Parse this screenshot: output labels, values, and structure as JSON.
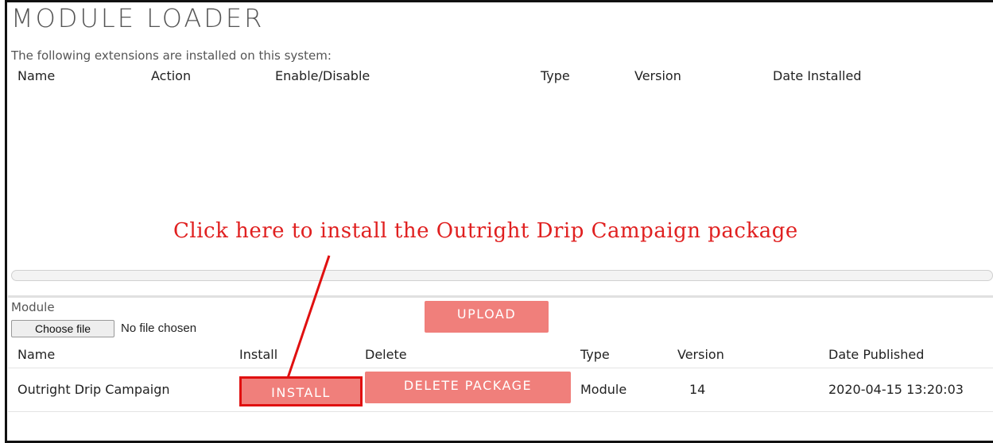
{
  "page": {
    "title": "MODULE LOADER",
    "intro": "The following extensions are installed on this system:"
  },
  "installed_table": {
    "columns": [
      "Name",
      "Action",
      "Enable/Disable",
      "Type",
      "Version",
      "Date Installed"
    ]
  },
  "annotation": {
    "text": "Click here to install the Outright Drip Campaign package",
    "color": "#e02020"
  },
  "upload": {
    "label": "Module",
    "choose_file": "Choose file",
    "file_status": "No file chosen",
    "upload_button": "UPLOAD"
  },
  "package_table": {
    "columns": [
      "Name",
      "Install",
      "Delete",
      "Type",
      "Version",
      "Date Published"
    ],
    "rows": [
      {
        "name": "Outright Drip Campaign",
        "install": "INSTALL",
        "delete": "DELETE PACKAGE",
        "type": "Module",
        "version": "14",
        "date_published": "2020-04-15 13:20:03"
      }
    ]
  },
  "colors": {
    "button": "#f07f7b",
    "highlight": "#e01010"
  }
}
